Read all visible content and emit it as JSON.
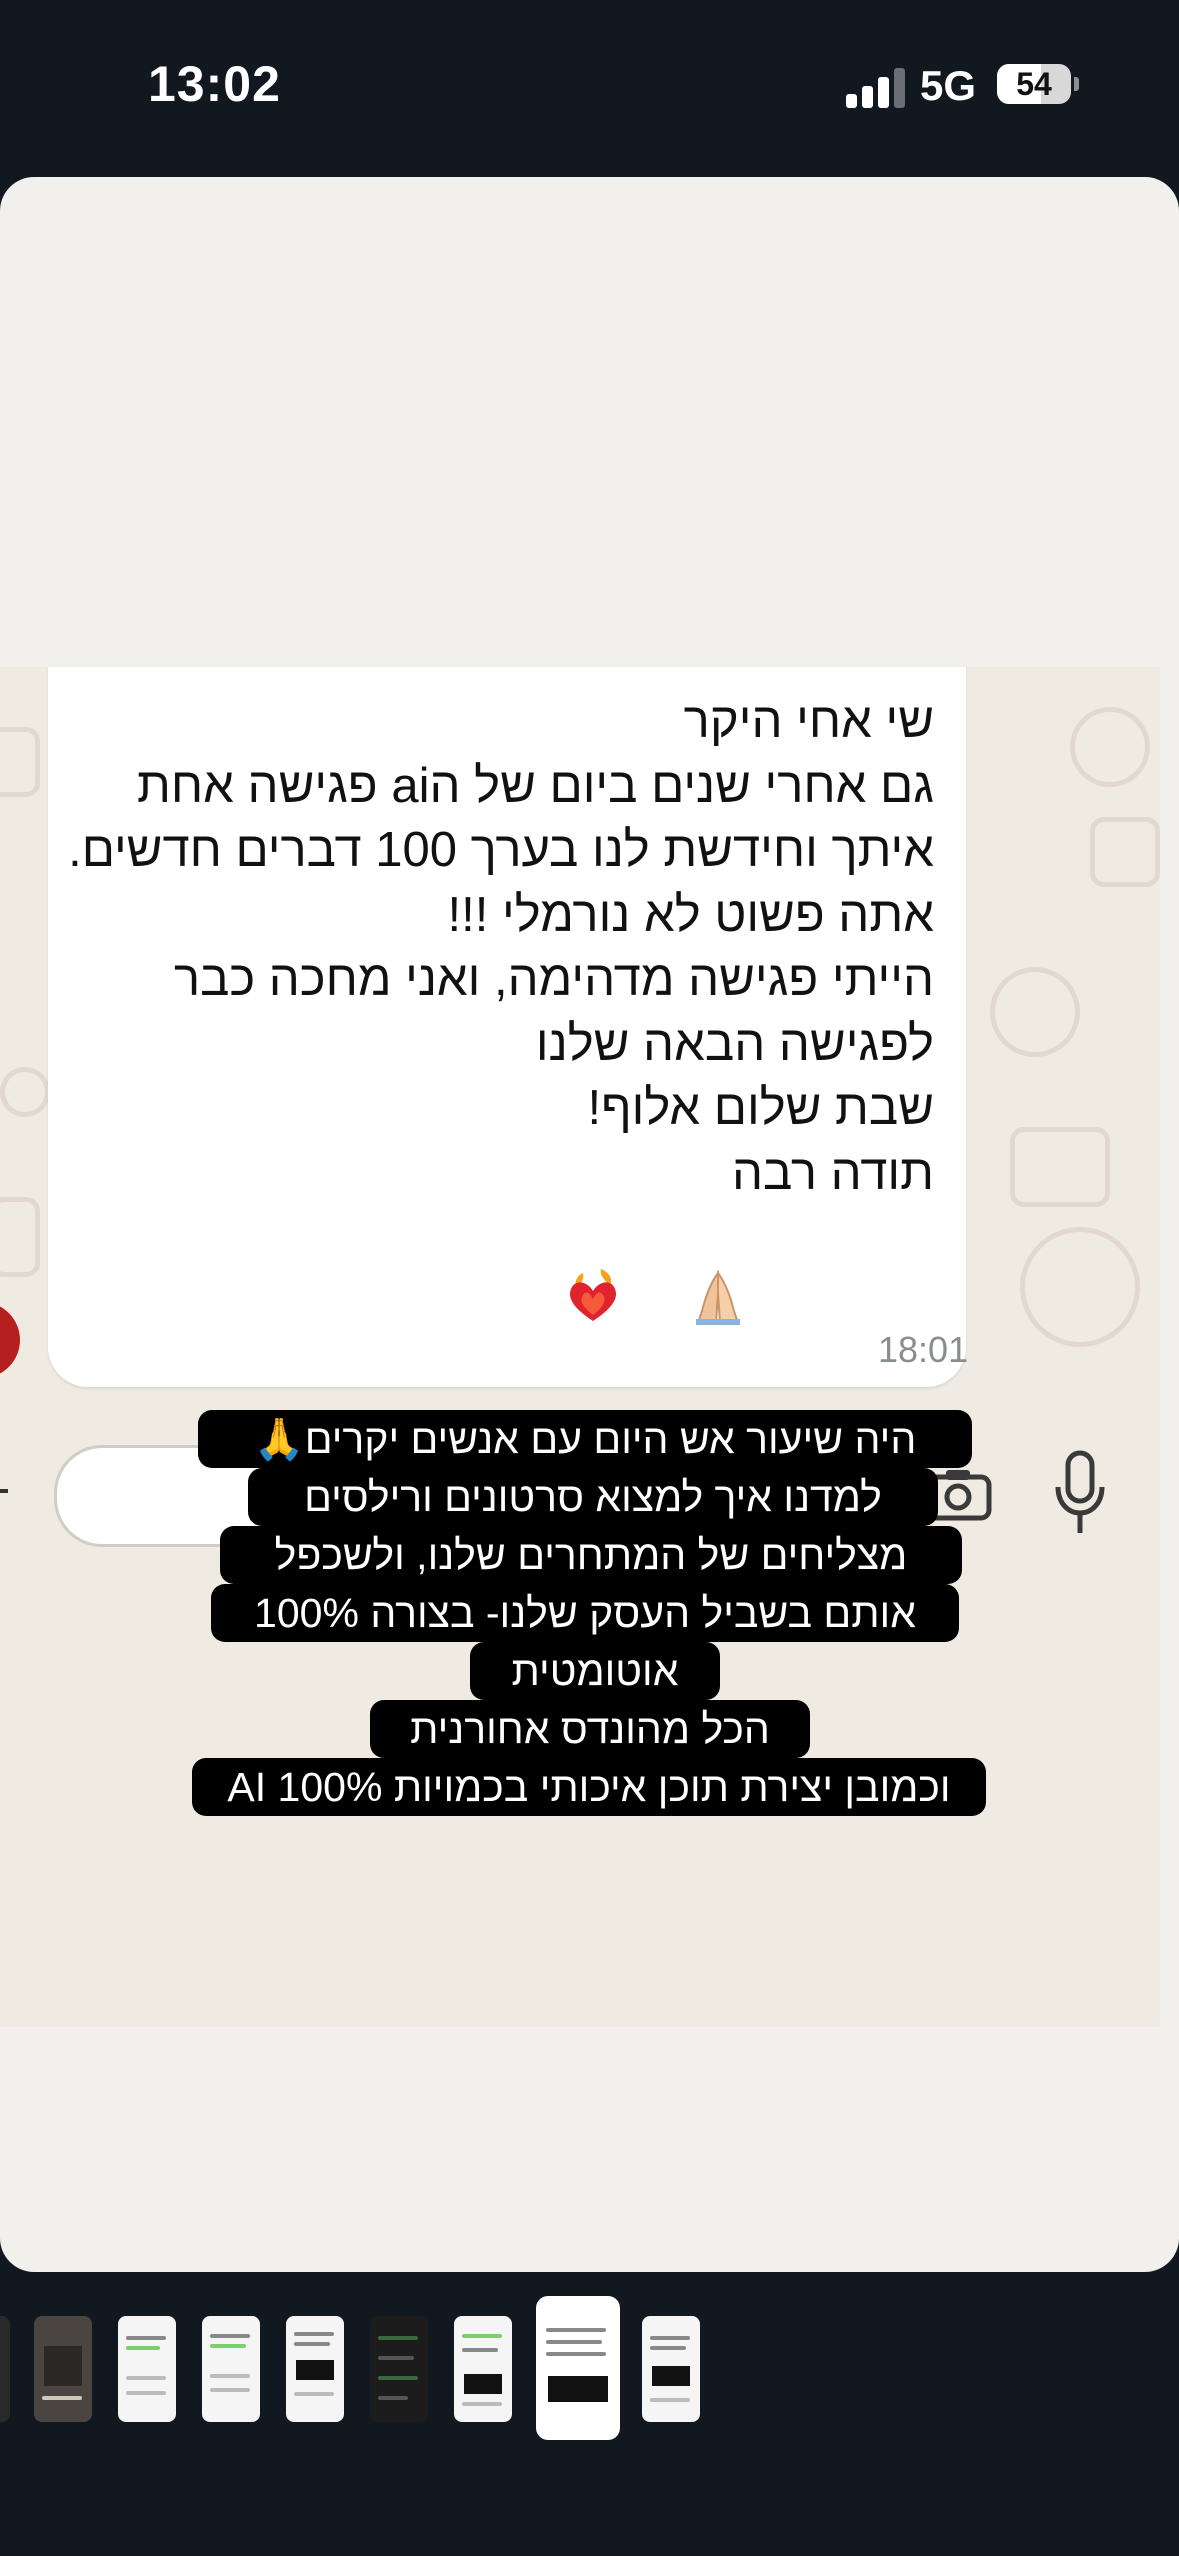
{
  "status_bar": {
    "time": "13:02",
    "network": "5G",
    "battery": "54",
    "battery_fill_fraction": 0.54,
    "signal_bars": 3
  },
  "chat_message": {
    "text": "שי אחי היקר\nגם אחרי שנים ביום של הai פגישה אחת איתך וחידשת לנו בערך 100 דברים חדשים.\nאתה פשוט לא נורמלי !!!\nהייתי פגישה מדהימה, ואני מחכה כבר לפגישה הבאה שלנו\nשבת שלום אלוף!\nתודה רבה",
    "emojis": [
      "🙏",
      "❤️‍🔥"
    ],
    "time": "18:01"
  },
  "caption": {
    "lines": [
      "היה שיעור אש היום עם אנשים יקרים🙏",
      "למדנו איך למצוא סרטונים ורילסים",
      "מצליחים של המתחרים שלנו, ולשכפל",
      "אותם בשביל העסק שלנו- בצורה 100%",
      "אוטומטית",
      "הכל מהונדס אחורנית",
      "וכמובן יצירת תוכן איכותי בכמויות AI 100%"
    ]
  },
  "icons": {
    "camera": "camera-icon",
    "mic": "microphone-icon",
    "plus": "plus-icon"
  },
  "colors": {
    "background": "#111820",
    "story_card": "#f2f0ed",
    "chat_wallpaper": "#efeae2",
    "bubble": "#ffffff",
    "caption_bg": "#000000"
  },
  "thumbnails": {
    "count": 9,
    "selected_index": 7
  }
}
